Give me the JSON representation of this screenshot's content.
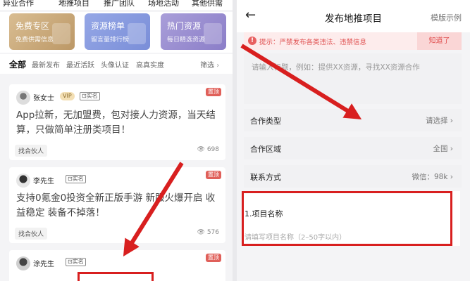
{
  "left": {
    "top_tabs": [
      "异业合作",
      "地推项目",
      "推广团队",
      "场地活动",
      "其他供需"
    ],
    "promo_cards": [
      {
        "title": "免费专区",
        "subtitle": "免费供需信息"
      },
      {
        "title": "资源榜单",
        "subtitle": "留言量排行榜"
      },
      {
        "title": "热门资源",
        "subtitle": "每日精选资源"
      }
    ],
    "filters": {
      "items": [
        "全部",
        "最新发布",
        "最近活跃",
        "头像认证",
        "高真实度"
      ],
      "screen": "筛选"
    },
    "posts": [
      {
        "name": "张女士",
        "vip": "VIP",
        "verified": "实名",
        "top_tag": "置顶",
        "text": "App拉新，无加盟费，包对接人力资源，当天结算，只做简单注册类项目！",
        "tag": "找合伙人",
        "views": "698"
      },
      {
        "name": "李先生",
        "verified": "实名",
        "top_tag": "置顶",
        "text": "支持0氪金0投资全新正版手游 新服火爆开启 收益稳定 装备不掉落！",
        "tag": "找合伙人",
        "views": "576"
      },
      {
        "name": "涂先生",
        "verified": "实名",
        "top_tag": "置顶",
        "text": ""
      }
    ]
  },
  "right": {
    "header": {
      "back_icon": "arrow-left-icon",
      "title": "发布地推项目",
      "sample_link": "模版示例"
    },
    "warning": {
      "text": "提示：严禁发布各类违法、违禁信息",
      "button": "知道了"
    },
    "description_placeholder": "请输入标题，例如：提供XX资源，寻找XX资源合作",
    "rows": [
      {
        "label": "合作类型",
        "value": "请选择"
      },
      {
        "label": "合作区域",
        "value": "全国"
      },
      {
        "label": "联系方式",
        "value": "微信：98k"
      }
    ],
    "project_name": {
      "label": "1.项目名称",
      "placeholder": "请填写项目名称（2–50字以内）"
    }
  },
  "annotation_color": "#d81f1f"
}
